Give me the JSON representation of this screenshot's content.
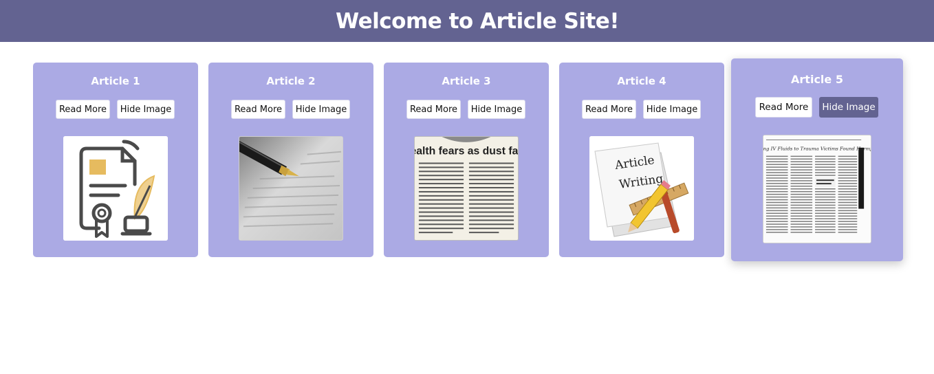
{
  "header": {
    "title": "Welcome to Article Site!"
  },
  "colors": {
    "header_bg": "#636391",
    "card_bg": "#abaae4",
    "active_button": "#636391"
  },
  "articles": [
    {
      "title": "Article 1",
      "read_label": "Read More",
      "hide_label": "Hide Image",
      "image_icon": "certificate-document-quill-icon"
    },
    {
      "title": "Article 2",
      "read_label": "Read More",
      "hide_label": "Hide Image",
      "image_icon": "fountain-pen-on-book-photo"
    },
    {
      "title": "Article 3",
      "read_label": "Read More",
      "hide_label": "Hide Image",
      "image_icon": "newspaper-clipping",
      "image_headline": "Health fears as dust falls"
    },
    {
      "title": "Article 4",
      "read_label": "Read More",
      "hide_label": "Hide Image",
      "image_icon": "article-writing-pencil-ruler-icon",
      "image_text": [
        "Article",
        "Writing"
      ]
    },
    {
      "title": "Article 5",
      "read_label": "Read More",
      "hide_label": "Hide Image",
      "image_icon": "newspaper-page",
      "image_headline": "Giving IV Fluids to Trauma Victims Found Harmful"
    }
  ]
}
